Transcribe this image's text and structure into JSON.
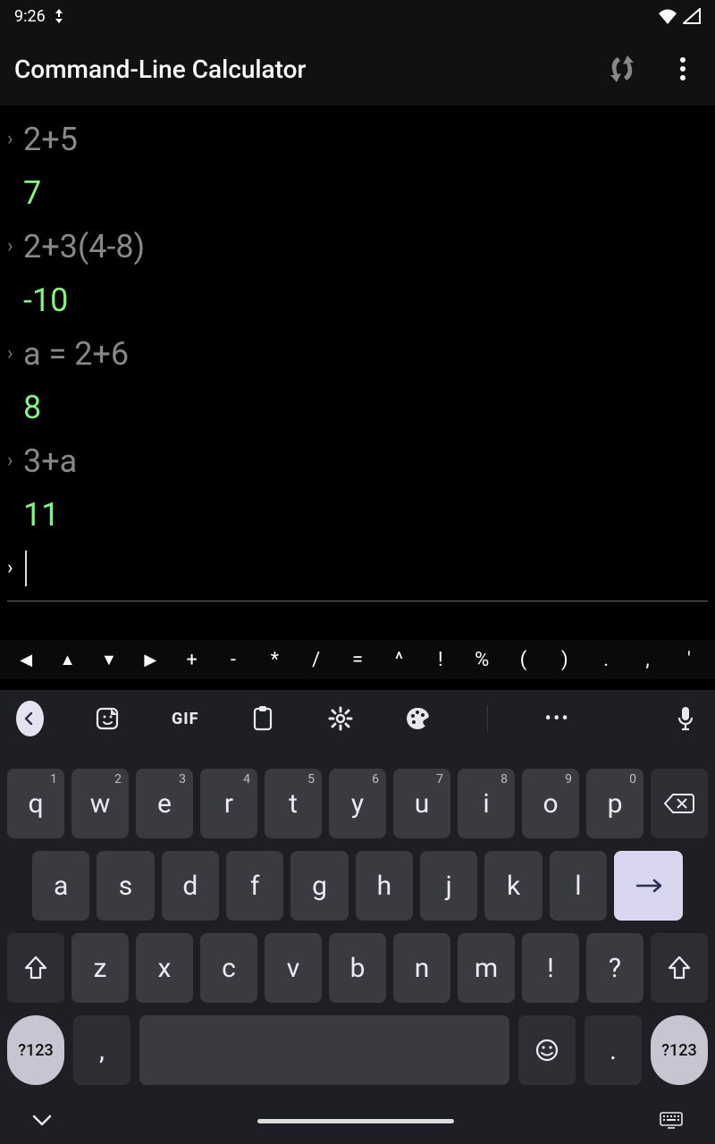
{
  "status": {
    "time": "9:26"
  },
  "app": {
    "title": "Command-Line Calculator"
  },
  "console": {
    "history": [
      {
        "in": "2+5",
        "out": "7"
      },
      {
        "in": "2+3(4-8)",
        "out": "-10"
      },
      {
        "in": "a = 2+6",
        "out": "8"
      },
      {
        "in": "3+a",
        "out": "11"
      }
    ],
    "prompt": "›",
    "input_prompt": "›"
  },
  "symbol_strip": [
    "◀",
    "▲",
    "▼",
    "▶",
    "+",
    "-",
    "*",
    "/",
    "=",
    "^",
    "!",
    "%",
    "(",
    ")",
    ".",
    ",",
    "'"
  ],
  "kb_toolbar": {
    "gif": "GIF",
    "dots": "•••"
  },
  "keyboard": {
    "row1": [
      {
        "k": "q",
        "h": "1"
      },
      {
        "k": "w",
        "h": "2"
      },
      {
        "k": "e",
        "h": "3"
      },
      {
        "k": "r",
        "h": "4"
      },
      {
        "k": "t",
        "h": "5"
      },
      {
        "k": "y",
        "h": "6"
      },
      {
        "k": "u",
        "h": "7"
      },
      {
        "k": "i",
        "h": "8"
      },
      {
        "k": "o",
        "h": "9"
      },
      {
        "k": "p",
        "h": "0"
      }
    ],
    "row2": [
      {
        "k": "a"
      },
      {
        "k": "s"
      },
      {
        "k": "d"
      },
      {
        "k": "f"
      },
      {
        "k": "g"
      },
      {
        "k": "h"
      },
      {
        "k": "j"
      },
      {
        "k": "k"
      },
      {
        "k": "l"
      }
    ],
    "row3": [
      {
        "k": "z"
      },
      {
        "k": "x"
      },
      {
        "k": "c"
      },
      {
        "k": "v"
      },
      {
        "k": "b"
      },
      {
        "k": "n"
      },
      {
        "k": "m"
      },
      {
        "k": "!"
      },
      {
        "k": "?"
      }
    ],
    "row4": {
      "numkey": "?123",
      "comma": ",",
      "dot": ".",
      "numkey2": "?123"
    }
  }
}
